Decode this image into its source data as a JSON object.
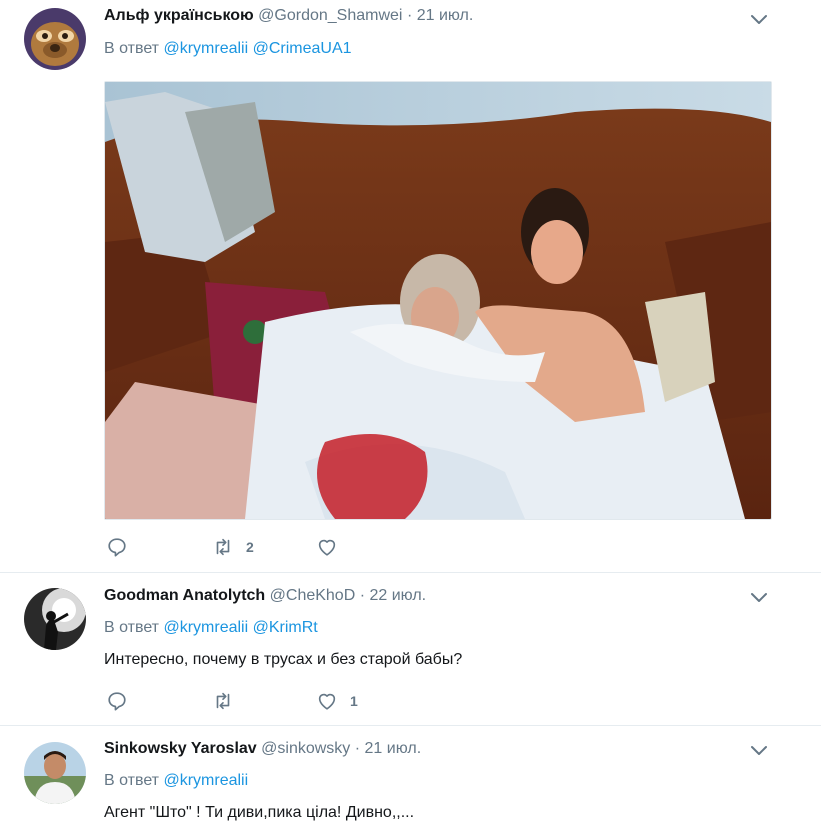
{
  "tweets": [
    {
      "name": "Альф українською",
      "handle": "@Gordon_Shamwei",
      "dot": "·",
      "date": "21 июл.",
      "reply_prefix": "В ответ",
      "mentions": [
        "@krymrealii",
        "@CrimeaUA1"
      ],
      "text": "",
      "retweets": "2",
      "likes": ""
    },
    {
      "name": "Goodman Anatolytch",
      "handle": "@CheKhoD",
      "dot": "·",
      "date": "22 июл.",
      "reply_prefix": "В ответ",
      "mentions": [
        "@krymrealii",
        "@KrimRt"
      ],
      "text": "Интересно, почему в трусах и без старой бабы?",
      "retweets": "",
      "likes": "1"
    },
    {
      "name": "Sinkowsky Yaroslav",
      "handle": "@sinkowsky",
      "dot": "·",
      "date": "21 июл.",
      "reply_prefix": "В ответ",
      "mentions": [
        "@krymrealii"
      ],
      "text": "Агент \"Што\" ! Ти диви,пика ціла! Дивно,,...",
      "retweets": "",
      "likes": ""
    }
  ],
  "icons": {
    "reply": "reply-icon",
    "retweet": "retweet-icon",
    "like": "heart-icon",
    "more": "chevron-down-icon"
  },
  "colors": {
    "link": "#1b95e0",
    "muted": "#657786",
    "text": "#14171a",
    "divider": "#e6ecf0"
  }
}
